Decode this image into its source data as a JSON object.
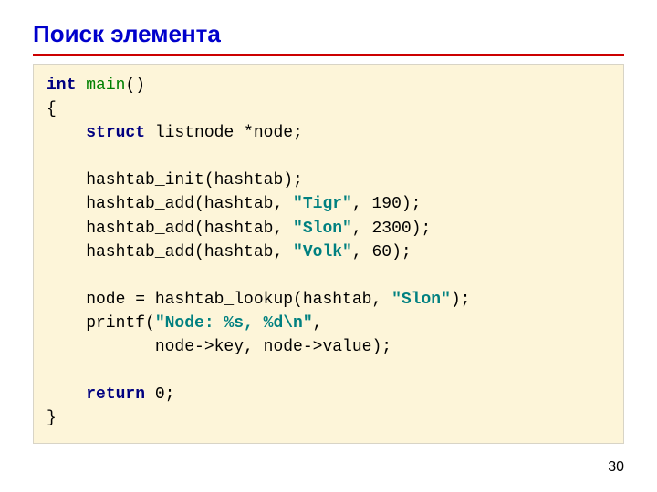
{
  "slide": {
    "title": "Поиск элемента",
    "page_number": "30"
  },
  "code": {
    "l1_kw_int": "int",
    "l1_fn": "main",
    "l1_rest": "()",
    "l2": "{",
    "l3_indent": "    ",
    "l3_kw_struct": "struct",
    "l3_rest": " listnode *node;",
    "l5": "    hashtab_init(hashtab);",
    "l6a": "    hashtab_add(hashtab, ",
    "l6s": "\"Tigr\"",
    "l6b": ", 190);",
    "l7a": "    hashtab_add(hashtab, ",
    "l7s": "\"Slon\"",
    "l7b": ", 2300);",
    "l8a": "    hashtab_add(hashtab, ",
    "l8s": "\"Volk\"",
    "l8b": ", 60);",
    "l10a": "    node = hashtab_lookup(hashtab, ",
    "l10s": "\"Slon\"",
    "l10b": ");",
    "l11a": "    printf(",
    "l11s": "\"Node: %s, %d\\n\"",
    "l11b": ",",
    "l12": "           node->key, node->value);",
    "l14_indent": "    ",
    "l14_kw_return": "return",
    "l14_rest": " 0;",
    "l15": "}"
  }
}
